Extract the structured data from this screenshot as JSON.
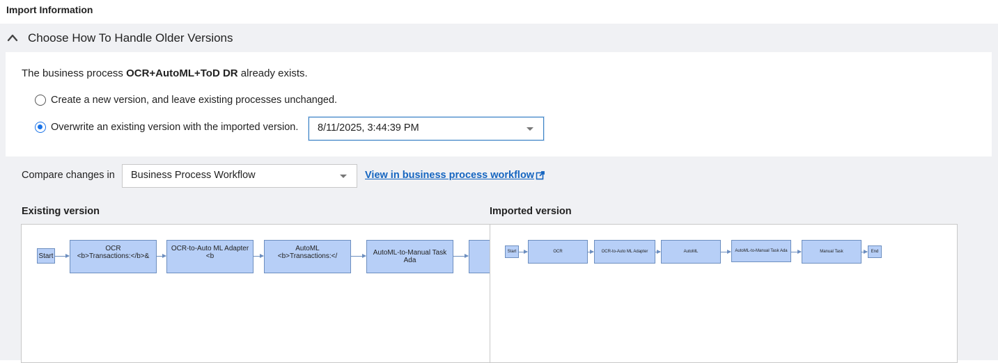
{
  "header": {
    "title": "Import Information"
  },
  "section": {
    "title": "Choose How To Handle Older Versions",
    "exists_prefix": "The business process ",
    "process_name": "OCR+AutoML+ToD DR",
    "exists_suffix": " already exists.",
    "options": [
      {
        "label": "Create a new version, and leave existing processes  unchanged.",
        "checked": false
      },
      {
        "label": "Overwrite an existing version with the imported version.",
        "checked": true
      }
    ],
    "version_select": {
      "value": "8/11/2025, 3:44:39 PM"
    }
  },
  "compare": {
    "label": "Compare changes in",
    "select_value": "Business Process Workflow",
    "link_text": "View in business process workflow"
  },
  "existing": {
    "title": "Existing version",
    "nodes": [
      {
        "lines": [
          "Start"
        ]
      },
      {
        "lines": [
          "OCR",
          "<b>Transactions:</b>&"
        ]
      },
      {
        "lines": [
          "OCR-to-Auto ML Adapter",
          "<b"
        ]
      },
      {
        "lines": [
          "AutoML",
          "<b>Transactions:</"
        ]
      },
      {
        "lines": [
          "AutoML-to-Manual Task Ada"
        ]
      },
      {
        "lines": [
          ""
        ]
      }
    ]
  },
  "imported": {
    "title": "Imported version",
    "nodes": [
      {
        "lines": [
          "Start"
        ]
      },
      {
        "lines": [
          "OCR"
        ]
      },
      {
        "lines": [
          "OCR-to-Auto ML Adapter"
        ]
      },
      {
        "lines": [
          "AutoML"
        ]
      },
      {
        "lines": [
          "AutoML-to-Manual Task Ada"
        ]
      },
      {
        "lines": [
          "Manual Task"
        ]
      },
      {
        "lines": [
          "End"
        ]
      }
    ]
  },
  "colors": {
    "accent": "#1a73e8",
    "link": "#1565c0",
    "node_fill": "#b7cff7",
    "node_border": "#6c8ebf"
  }
}
